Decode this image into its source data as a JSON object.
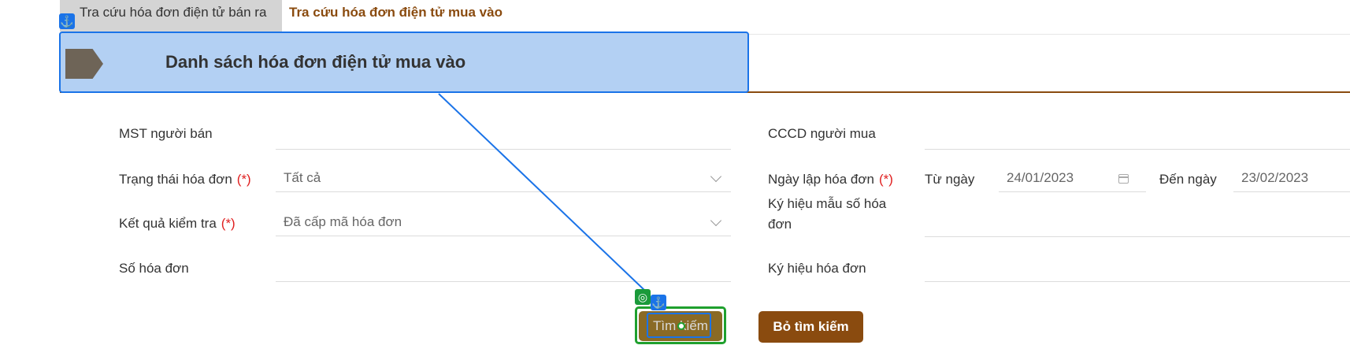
{
  "tabs": [
    {
      "label": "Tra cứu hóa đơn điện tử bán ra",
      "active": false
    },
    {
      "label": "Tra cứu hóa đơn điện tử mua vào",
      "active": true
    }
  ],
  "header": {
    "title": "Danh sách hóa đơn điện tử mua vào"
  },
  "form": {
    "mst_nguoi_ban": {
      "label": "MST người bán",
      "value": ""
    },
    "cccd_nguoi_mua": {
      "label": "CCCD người mua",
      "value": ""
    },
    "trang_thai": {
      "label": "Trạng thái hóa đơn",
      "required": "(*)",
      "value": "Tất cả"
    },
    "ngay_lap": {
      "label": "Ngày lập hóa đơn",
      "required": "(*)",
      "from_label": "Từ ngày",
      "from_value": "24/01/2023",
      "to_label": "Đến ngày",
      "to_value": "23/02/2023"
    },
    "ket_qua_kiem_tra": {
      "label": "Kết quả kiểm tra",
      "required": "(*)",
      "value": "Đã cấp mã hóa đơn"
    },
    "ky_hieu_mau_so": {
      "label_line1": "Ký hiệu mẫu số hóa",
      "label_line2": "đơn",
      "value": ""
    },
    "so_hoa_don": {
      "label": "Số hóa đơn",
      "value": ""
    },
    "ky_hieu_hoa_don": {
      "label": "Ký hiệu hóa đơn",
      "value": ""
    }
  },
  "buttons": {
    "search": "Tìm kiếm",
    "clear": "Bỏ tìm kiếm"
  },
  "icons": {
    "anchor": "⚓",
    "target": "◎"
  },
  "colors": {
    "brand": "#8a4b0f",
    "highlight_border": "#1a73e8",
    "highlight_fill": "#b3d0f3",
    "target_green": "#1fa02e",
    "required": "#e02020"
  }
}
